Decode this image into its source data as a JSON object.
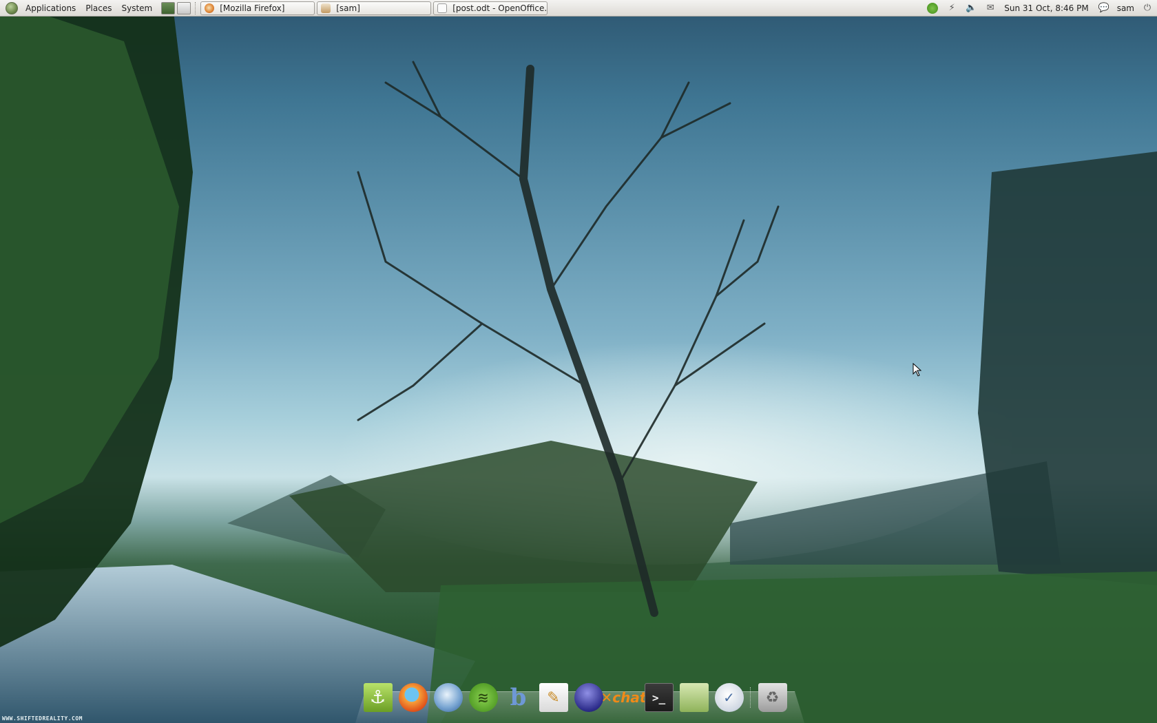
{
  "top_panel": {
    "menus": {
      "applications": "Applications",
      "places": "Places",
      "system": "System"
    },
    "tasks": [
      {
        "label": "[Mozilla Firefox]",
        "icon": "firefox-icon"
      },
      {
        "label": "[sam]",
        "icon": "folder-icon"
      },
      {
        "label": "[post.odt - OpenOffice...",
        "icon": "document-icon"
      }
    ],
    "tray": {
      "clock": "Sun 31 Oct,  8:46 PM",
      "user": "sam",
      "icons": [
        "spotify-icon",
        "network-icon",
        "volume-icon",
        "mail-icon",
        "chat-status-icon",
        "power-icon"
      ]
    }
  },
  "dock": {
    "items": [
      {
        "name": "anchor",
        "glyph": "⚓"
      },
      {
        "name": "firefox",
        "glyph": ""
      },
      {
        "name": "thunderbird",
        "glyph": ""
      },
      {
        "name": "spotify",
        "glyph": "≋"
      },
      {
        "name": "beshare",
        "glyph": "b"
      },
      {
        "name": "text-editor",
        "glyph": "✎"
      },
      {
        "name": "eclipse",
        "glyph": ""
      },
      {
        "name": "xchat",
        "glyph": "✕chat"
      },
      {
        "name": "terminal",
        "glyph": ">_"
      },
      {
        "name": "archive",
        "glyph": ""
      },
      {
        "name": "update-manager",
        "glyph": "✓"
      },
      {
        "name": "trash",
        "glyph": "♻"
      }
    ]
  },
  "wallpaper": {
    "watermark": "WWW.SHIFTEDREALITY.COM"
  },
  "colors": {
    "panel": "#dcdad5",
    "sky": "#7fb0c6",
    "grass": "#2e5a36"
  }
}
